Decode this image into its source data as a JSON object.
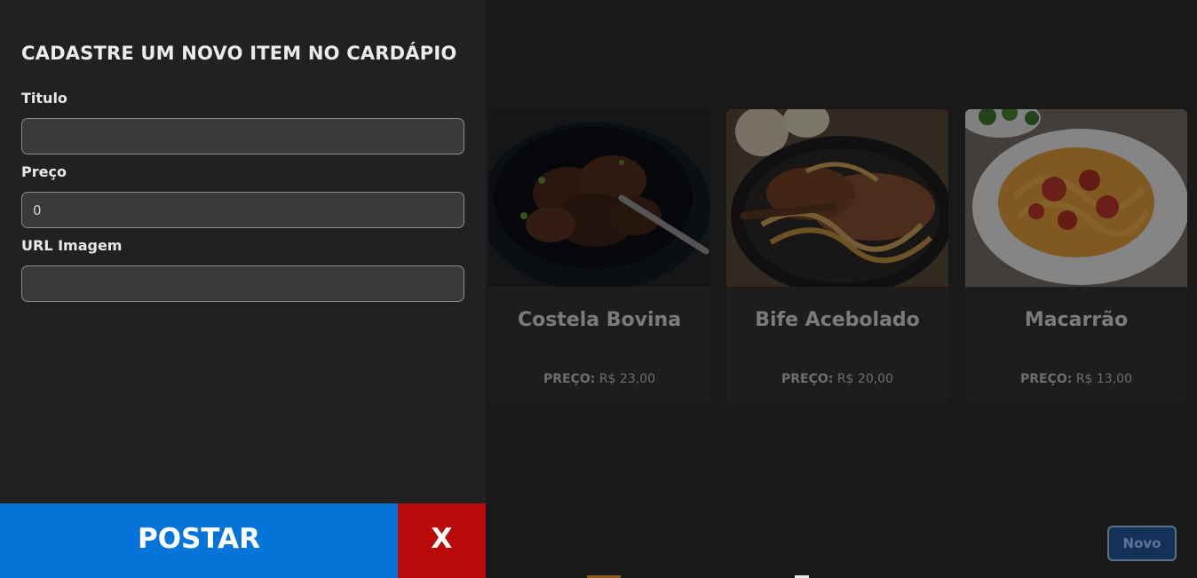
{
  "drawer": {
    "title": "CADASTRE UM NOVO ITEM NO CARDÁPIO",
    "fields": [
      {
        "label": "Titulo",
        "value": ""
      },
      {
        "label": "Preço",
        "value": "0"
      },
      {
        "label": "URL Imagem",
        "value": ""
      }
    ],
    "submit_label": "POSTAR",
    "close_label": "X"
  },
  "menu": {
    "price_prefix": "PREÇO:",
    "items": [
      {
        "title": "Costela Bovina",
        "price": "R$ 23,00"
      },
      {
        "title": "Bife Acebolado",
        "price": "R$ 20,00"
      },
      {
        "title": "Macarrão",
        "price": "R$ 13,00"
      }
    ],
    "new_button_label": "Novo"
  },
  "colors": {
    "background": "#191919",
    "drawer": "#222122",
    "submit": "#0474d9",
    "close": "#b80a0a"
  }
}
